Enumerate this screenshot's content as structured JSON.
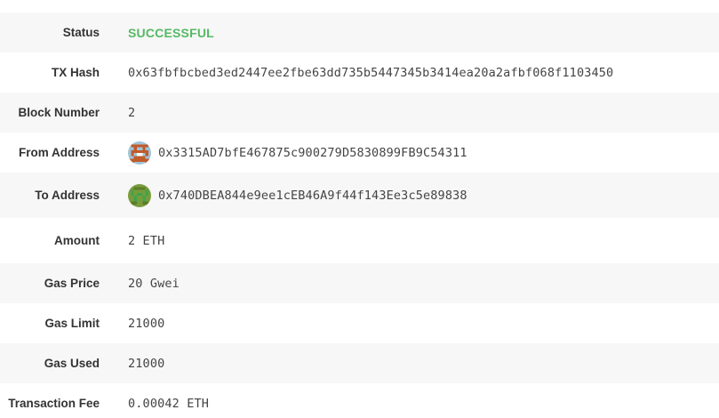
{
  "transaction": {
    "status": {
      "label": "Status",
      "value": "SUCCESSFUL",
      "color": "#55b963"
    },
    "tx_hash": {
      "label": "TX Hash",
      "value": "0x63fbfbcbed3ed2447ee2fbe63dd735b5447345b3414ea20a2afbf068f1103450"
    },
    "block_number": {
      "label": "Block Number",
      "value": "2"
    },
    "from_address": {
      "label": "From Address",
      "value": "0x3315AD7bfE467875c900279D5830899FB9C54311",
      "avatar_icon": "identicon-avatar"
    },
    "to_address": {
      "label": "To Address",
      "value": "0x740DBEA844e9ee1cEB46A9f44f143Ee3c5e89838",
      "avatar_icon": "identicon-avatar"
    },
    "amount": {
      "label": "Amount",
      "value": "2 ETH"
    },
    "gas_price": {
      "label": "Gas Price",
      "value": "20 Gwei"
    },
    "gas_limit": {
      "label": "Gas Limit",
      "value": "21000"
    },
    "gas_used": {
      "label": "Gas Used",
      "value": "21000"
    },
    "transaction_fee": {
      "label": "Transaction Fee",
      "value": "0.00042 ETH"
    }
  },
  "colors": {
    "row_alt_bg": "#f7f7f7",
    "label_text": "#333333",
    "value_text": "#444444"
  }
}
